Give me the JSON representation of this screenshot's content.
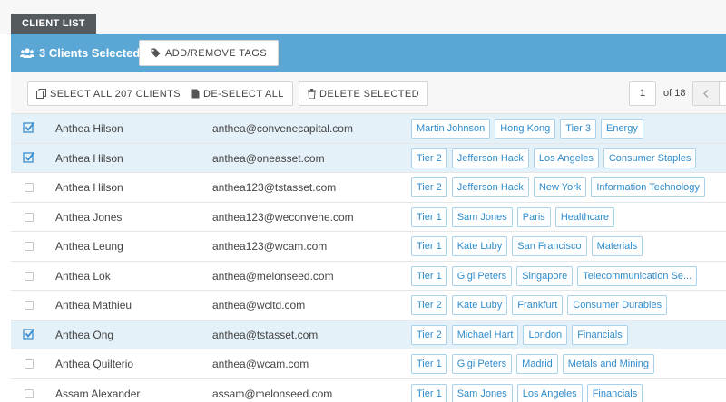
{
  "tab": {
    "label": "CLIENT LIST"
  },
  "selection": {
    "count_text": "3 Clients Selected",
    "tags_button": "ADD/REMOVE TAGS"
  },
  "toolbar": {
    "select_all": "SELECT ALL 207 CLIENTS",
    "deselect_all": "DE-SELECT ALL",
    "delete_selected": "DELETE SELECTED"
  },
  "pagination": {
    "current_page": "1",
    "of_text": "of 18"
  },
  "colors": {
    "accent": "#5aa7d5",
    "tag_text": "#2f8ccc",
    "tag_border": "#a9d3ec",
    "selected_row": "#e5f1f8",
    "tab_bg": "#555a5e"
  },
  "clients": [
    {
      "selected": true,
      "name": "Anthea Hilson",
      "email": "anthea@convenecapital.com",
      "tags": [
        "Martin Johnson",
        "Hong Kong",
        "Tier 3",
        "Energy"
      ]
    },
    {
      "selected": true,
      "name": "Anthea Hilson",
      "email": "anthea@oneasset.com",
      "tags": [
        "Tier 2",
        "Jefferson Hack",
        "Los Angeles",
        "Consumer Staples"
      ]
    },
    {
      "selected": false,
      "name": "Anthea Hilson",
      "email": "anthea123@tstasset.com",
      "tags": [
        "Tier 2",
        "Jefferson Hack",
        "New York",
        "Information Technology"
      ]
    },
    {
      "selected": false,
      "name": "Anthea Jones",
      "email": "anthea123@weconvene.com",
      "tags": [
        "Tier 1",
        "Sam Jones",
        "Paris",
        "Healthcare"
      ]
    },
    {
      "selected": false,
      "name": "Anthea Leung",
      "email": "anthea123@wcam.com",
      "tags": [
        "Tier 1",
        "Kate Luby",
        "San Francisco",
        "Materials"
      ]
    },
    {
      "selected": false,
      "name": "Anthea Lok",
      "email": "anthea@melonseed.com",
      "tags": [
        "Tier 1",
        "Gigi Peters",
        "Singapore",
        "Telecommunication Se..."
      ]
    },
    {
      "selected": false,
      "name": "Anthea Mathieu",
      "email": "anthea@wcltd.com",
      "tags": [
        "Tier 2",
        "Kate Luby",
        "Frankfurt",
        "Consumer Durables"
      ]
    },
    {
      "selected": true,
      "name": "Anthea Ong",
      "email": "anthea@tstasset.com",
      "tags": [
        "Tier 2",
        "Michael Hart",
        "London",
        "Financials"
      ]
    },
    {
      "selected": false,
      "name": "Anthea Quilterio",
      "email": "anthea@wcam.com",
      "tags": [
        "Tier 1",
        "Gigi Peters",
        "Madrid",
        "Metals and Mining"
      ]
    },
    {
      "selected": false,
      "name": "Assam Alexander",
      "email": "assam@melonseed.com",
      "tags": [
        "Tier 1",
        "Sam Jones",
        "Los Angeles",
        "Financials"
      ]
    }
  ]
}
